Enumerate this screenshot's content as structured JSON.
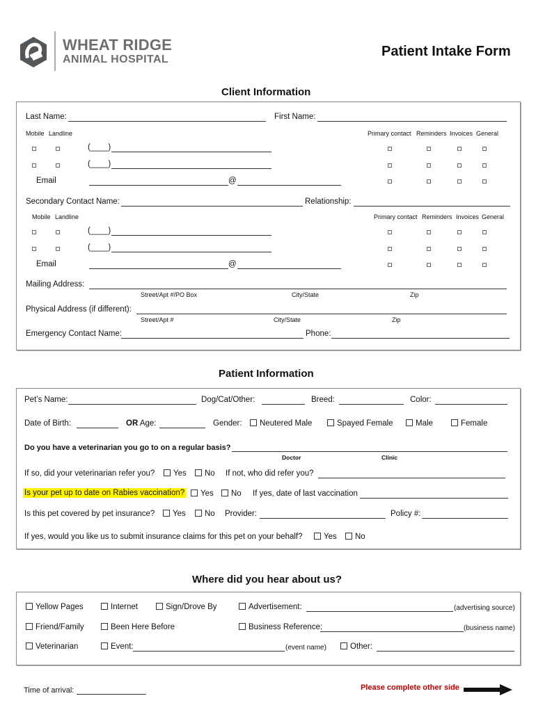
{
  "header": {
    "logo_line1": "WHEAT RIDGE",
    "logo_line2": "ANIMAL HOSPITAL",
    "logo_icon": "hexagon-e-logo",
    "form_title": "Patient Intake Form"
  },
  "client": {
    "section_title": "Client Information",
    "last_name_label": "Last Name:",
    "first_name_label": "First Name:",
    "mobile_label": "Mobile",
    "landline_label": "Landline",
    "pref_headers": [
      "Primary contact",
      "Reminders",
      "Invoices",
      "General"
    ],
    "phone_prefix": "(____)",
    "email_label": "Email",
    "at_symbol": "@",
    "secondary_label": "Secondary Contact Name:",
    "relationship_label": "Relationship:",
    "mailing_label": "Mailing Address:",
    "mailing_sub": [
      "Street/Apt #/PO Box",
      "City/State",
      "Zip"
    ],
    "physical_label": "Physical Address (if different):",
    "physical_sub": [
      "Street/Apt #",
      "City/State",
      "Zip"
    ],
    "emergency_label": "Emergency Contact Name:",
    "phone_label": "Phone:"
  },
  "patient": {
    "section_title": "Patient Information",
    "pet_name_label": "Pet’s Name:",
    "species_label": "Dog/Cat/Other:",
    "breed_label": "Breed:",
    "color_label": "Color:",
    "dob_label": "Date of Birth:",
    "or_label": "OR",
    "age_label": "Age:",
    "gender_label": "Gender:",
    "gender_options": [
      "Neutered Male",
      "Spayed Female",
      "Male",
      "Female"
    ],
    "vet_question": "Do you have a veterinarian you go to on a regular basis?",
    "doctor_label": "Doctor",
    "clinic_label": "Clinic",
    "refer_question": "If so, did your veterinarian refer you?",
    "yes_label": "Yes",
    "no_label": "No",
    "who_refer_label": "If not, who did refer you?",
    "rabies_question": "Is your pet up to date on Rabies vaccination?",
    "last_vacc_label": "If yes, date of last vaccination",
    "insurance_question": "Is this pet covered by pet insurance?",
    "provider_label": "Provider:",
    "policy_label": "Policy #:",
    "claims_question": "If yes, would you like us to submit insurance claims for this pet on your behalf?",
    "highlight_color": "#fff200"
  },
  "referral": {
    "section_title": "Where did you hear about us?",
    "options": {
      "yellow_pages": "Yellow Pages",
      "internet": "Internet",
      "sign": "Sign/Drove By",
      "advertisement": "Advertisement:",
      "advertisement_hint": "(advertising source)",
      "friend": "Friend/Family",
      "been_here": "Been Here Before",
      "business": "Business Reference:",
      "business_hint": "(business name)",
      "veterinarian": "Veterinarian",
      "event": "Event:",
      "event_hint": "(event name)",
      "other": "Other:"
    }
  },
  "footer": {
    "time_label": "Time of arrival:",
    "other_side_note": "Please complete other side",
    "note_color": "#c00000"
  }
}
